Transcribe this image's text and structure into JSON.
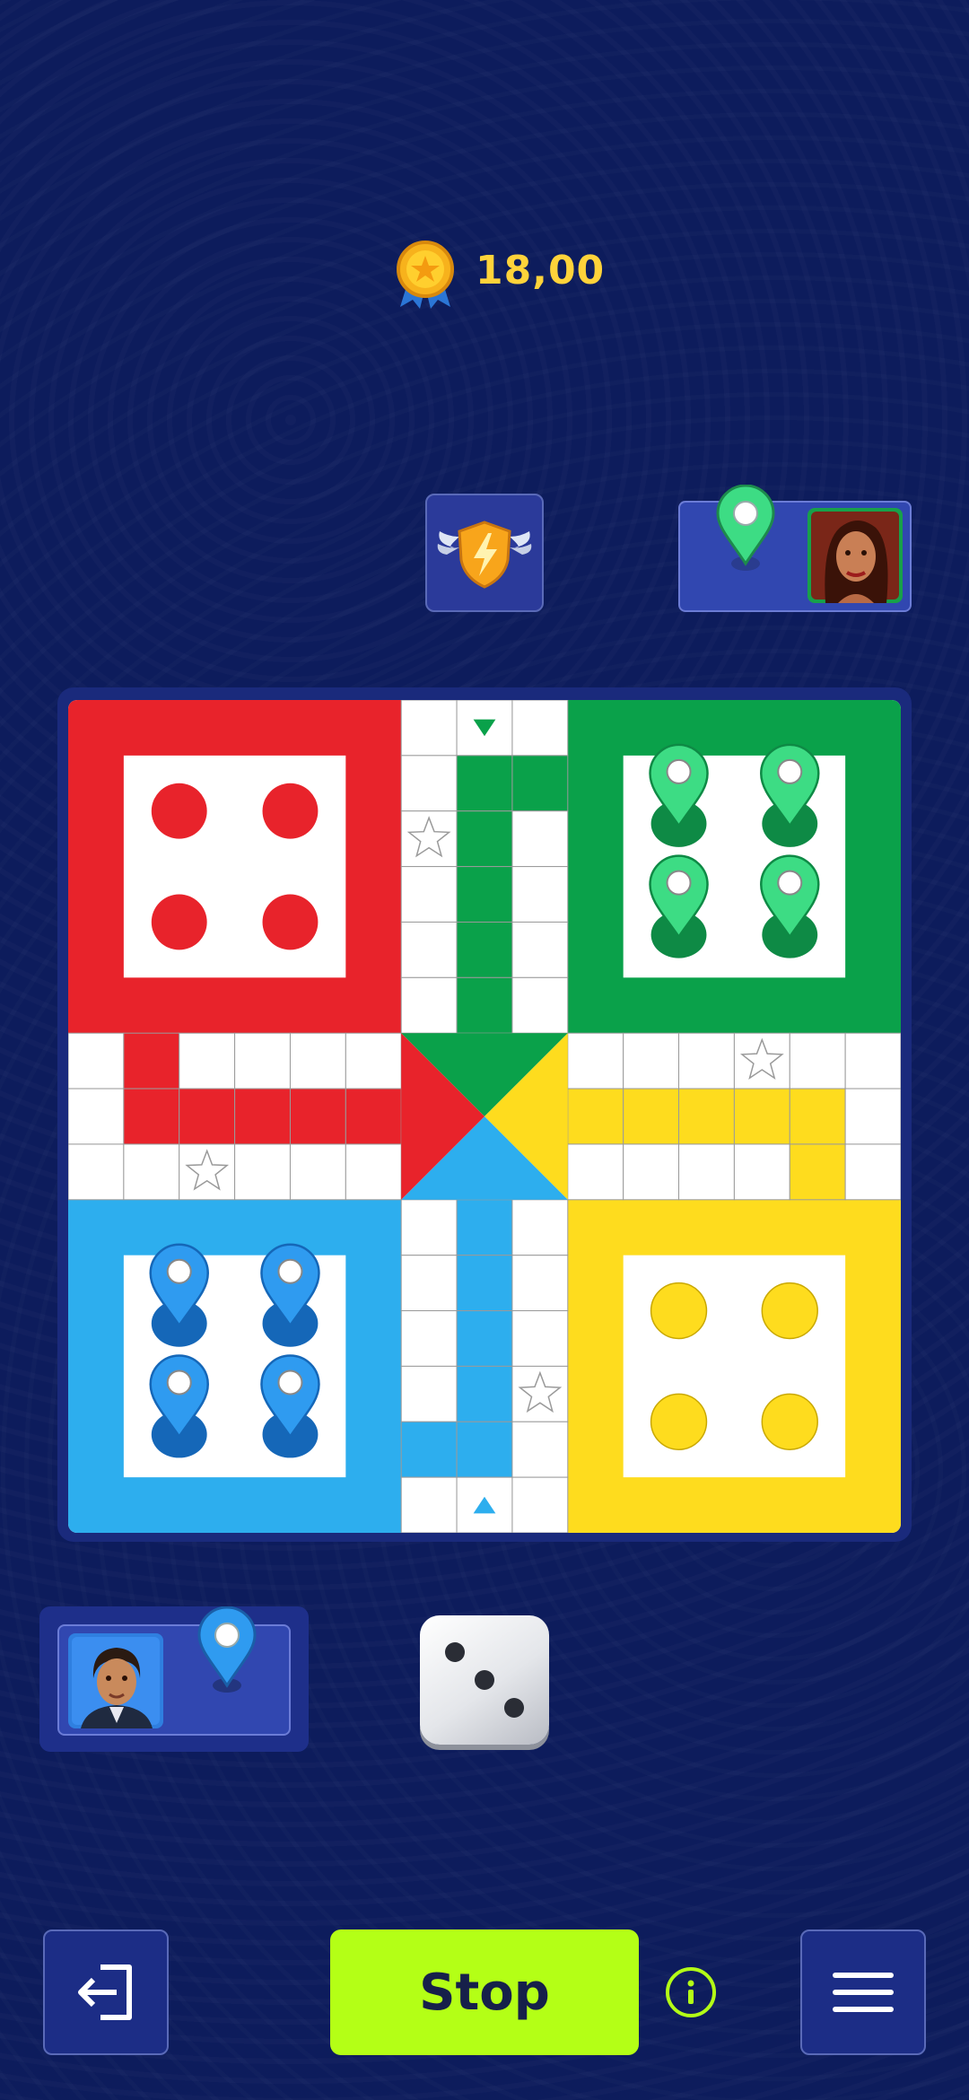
{
  "score": {
    "value": "18,00",
    "icon": "medal-star-icon"
  },
  "powerup": {
    "icon": "winged-shield-lightning-icon"
  },
  "opponent": {
    "color": "#3ddc84",
    "token_icon": "green-pin-icon",
    "avatar": "female-avatar"
  },
  "player": {
    "color": "#2f9bf0",
    "token_icon": "blue-pin-icon",
    "avatar": "male-avatar"
  },
  "board": {
    "colors": {
      "red": "#e8232b",
      "green": "#0aa14a",
      "yellow": "#fedc1e",
      "blue": "#2daeee"
    },
    "red_tokens_in_base": 4,
    "green_tokens_in_base": 4,
    "yellow_tokens_in_base": 4,
    "blue_tokens_in_base": 4
  },
  "dice": {
    "value": 3
  },
  "controls": {
    "stop_label": "Stop",
    "exit_icon": "exit-icon",
    "info_icon": "info-icon",
    "menu_icon": "hamburger-menu-icon"
  },
  "theme": {
    "background": "#0d1c5c",
    "accent": "#b4ff16"
  }
}
